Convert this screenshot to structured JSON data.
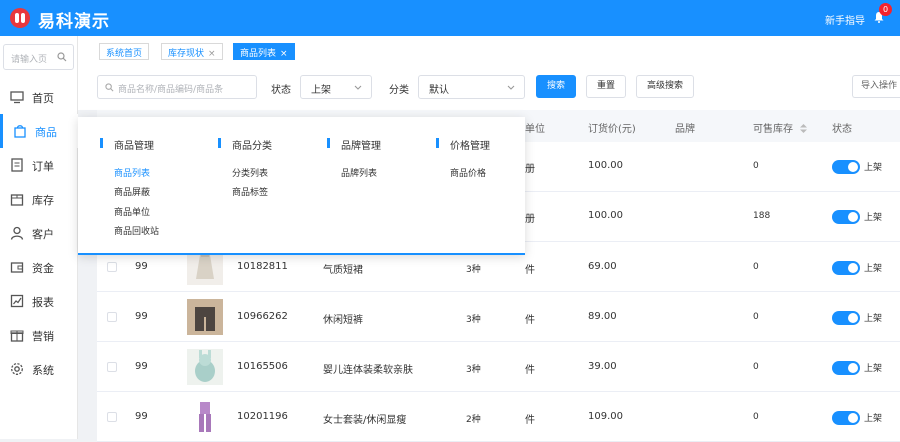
{
  "app": {
    "title": "易科演示",
    "guide": "新手指导",
    "badge": "0"
  },
  "sidebar": {
    "search_placeholder": "请输入页",
    "items": [
      {
        "label": "首页",
        "icon": "monitor-icon"
      },
      {
        "label": "商品",
        "icon": "bag-icon",
        "active": true
      },
      {
        "label": "订单",
        "icon": "document-icon"
      },
      {
        "label": "库存",
        "icon": "box-icon"
      },
      {
        "label": "客户",
        "icon": "user-icon"
      },
      {
        "label": "资金",
        "icon": "wallet-icon"
      },
      {
        "label": "报表",
        "icon": "chart-icon"
      },
      {
        "label": "营销",
        "icon": "gift-icon"
      },
      {
        "label": "系统",
        "icon": "gear-icon"
      }
    ]
  },
  "tabs": [
    {
      "label": "系统首页",
      "closable": false
    },
    {
      "label": "库存现状",
      "closable": true
    },
    {
      "label": "商品列表",
      "closable": true,
      "active": true
    }
  ],
  "filters": {
    "search_placeholder": "商品名称/商品编码/商品条",
    "status_label": "状态",
    "status_value": "上架",
    "category_label": "分类",
    "category_value": "默认",
    "search_button": "搜索",
    "reset_button": "重置",
    "advanced_button": "高级搜索",
    "import_button": "导入操作"
  },
  "table": {
    "headers": {
      "unit": "单位",
      "price": "订货价(元)",
      "brand": "品牌",
      "stock": "可售库存",
      "status": "状态"
    },
    "rows": [
      {
        "seq": "",
        "code": "",
        "name": "",
        "spec": "",
        "unit": "册",
        "price": "100.00",
        "stock": "0",
        "status": "上架"
      },
      {
        "seq": "",
        "code": "",
        "name": "",
        "spec": "",
        "unit": "册",
        "price": "100.00",
        "stock": "188",
        "status": "上架"
      },
      {
        "seq": "99",
        "code": "10182811",
        "name": "气质短裙",
        "spec": "3种",
        "unit": "件",
        "price": "69.00",
        "stock": "0",
        "status": "上架"
      },
      {
        "seq": "99",
        "code": "10966262",
        "name": "休闲短裤",
        "spec": "3种",
        "unit": "件",
        "price": "89.00",
        "stock": "0",
        "status": "上架"
      },
      {
        "seq": "99",
        "code": "10165506",
        "name": "婴儿连体装柔软亲肤",
        "spec": "3种",
        "unit": "件",
        "price": "39.00",
        "stock": "0",
        "status": "上架"
      },
      {
        "seq": "99",
        "code": "10201196",
        "name": "女士套装/休闲显瘦",
        "spec": "2种",
        "unit": "件",
        "price": "109.00",
        "stock": "0",
        "status": "上架"
      }
    ]
  },
  "mega_menu": {
    "columns": [
      {
        "title": "商品管理",
        "links": [
          "商品列表",
          "商品屏蔽",
          "商品单位",
          "商品回收站"
        ]
      },
      {
        "title": "商品分类",
        "links": [
          "分类列表",
          "商品标签"
        ]
      },
      {
        "title": "品牌管理",
        "links": [
          "品牌列表"
        ]
      },
      {
        "title": "价格管理",
        "links": [
          "商品价格"
        ]
      }
    ]
  },
  "colors": {
    "primary": "#1890ff",
    "logo": "#e8383d",
    "badge": "#f5222d"
  }
}
